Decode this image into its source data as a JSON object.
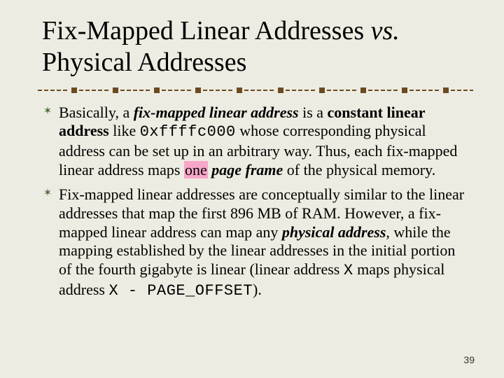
{
  "title": {
    "line1_a": "Fix-Mapped Linear Addresses ",
    "line1_vs": "vs.",
    "line2": "Physical Addresses"
  },
  "bullets": [
    {
      "p1": "Basically, a ",
      "em1": "fix-mapped linear address",
      "p2": " is a ",
      "b1": "constant linear address",
      "p3": " like ",
      "mono1": "0xffffc000",
      "p4": " whose corresponding physical address can be set up in an arbitrary way. Thus, each fix-mapped linear address maps ",
      "hl": "one",
      "em2": " page frame",
      "p5": " of the physical memory."
    },
    {
      "p1": "Fix-mapped linear addresses are conceptually similar to the linear addresses that map the first 896 MB of RAM. However, a fix-mapped linear address can map any ",
      "em1": "physical address",
      "p2": ", while the mapping established by the linear addresses in the initial portion of the fourth gigabyte is linear (linear address ",
      "monoX1": "X",
      "p3": " maps physical address ",
      "mono2": "X - PAGE_OFFSET",
      "p4": ")."
    }
  ],
  "pagenum": "39"
}
